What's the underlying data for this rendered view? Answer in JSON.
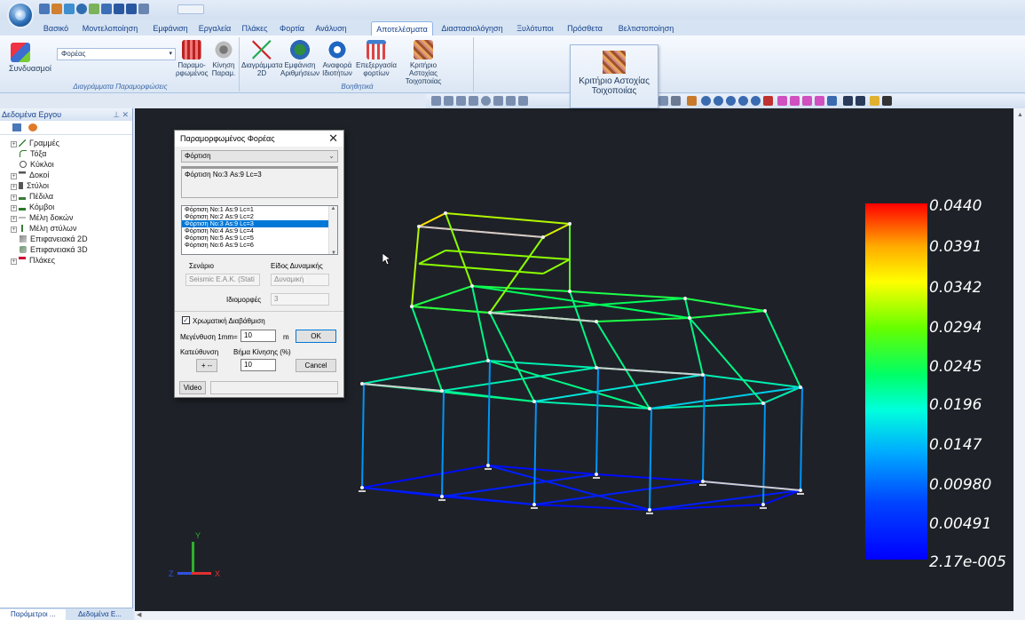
{
  "ribbon": {
    "tabs": [
      "Βασικό",
      "Μοντελοποίηση",
      "Εμφάνιση",
      "Εργαλεία",
      "Πλάκες",
      "Φορτία",
      "Ανάλυση",
      "Αποτελέσματα",
      "Διαστασιολόγηση",
      "Ξυλότυποι",
      "Πρόσθετα",
      "Βελτιστοποίηση"
    ],
    "active_tab": "Αποτελέσματα",
    "group1": {
      "label": "Διαγράμματα Παραμορφώσεις",
      "combos_label": "Συνδυασμοί",
      "combo_value": "Φορέας",
      "btn_paramorfomenos": "Παραμο- ρφωμένος",
      "btn_kinisi": "Κίνηση Παραμ."
    },
    "group2": {
      "label": "Βοηθητικά",
      "btn_diagrammata": "Διαγράμματα 2D",
      "btn_emfanisi": "Εμφάνιση Αριθμήσεων",
      "btn_anafora": "Αναφορά Ιδιοτήτων",
      "btn_epexergasia": "Επεξεργασία φορτίων",
      "btn_kritirio": "Κριτήριο Αστοχίας Τοιχοποιίας"
    },
    "tooltip": "Κριτήριο Αστοχίας Τοιχοποιίας"
  },
  "left_panel": {
    "title": "Δεδομένα Εργου",
    "pin": "⊥ ✕",
    "items": [
      "Γραμμές",
      "Τόξα",
      "Κύκλοι",
      "Δοκοί",
      "Στύλοι",
      "Πέδιλα",
      "Κόμβοι",
      "Μέλη δοκών",
      "Μέλη στύλων",
      "Επιφανειακά 2D",
      "Επιφανειακά 3D",
      "Πλάκες"
    ],
    "bottom_tabs": [
      "Παράμετροι ...",
      "Δεδομένα Ε..."
    ]
  },
  "dialog": {
    "title": "Παραμορφωμένος Φορέας",
    "combo_value": "Φόρτιση",
    "info_text": "Φόρτιση Νο:3 As:9 Lc=3",
    "list": [
      "Φόρτιση Νο:1 As:9 Lc=1",
      "Φόρτιση Νο:2 As:9 Lc=2",
      "Φόρτιση Νο:3 As:9 Lc=3",
      "Φόρτιση Νο:4 As:9 Lc=4",
      "Φόρτιση Νο:5 As:9 Lc=5",
      "Φόρτιση Νο:6 As:9 Lc=6"
    ],
    "selected_index": 2,
    "senario_label": "Σενάριο",
    "senario_value": "Seismic E.A.K. (Stati",
    "eidos_label": "Είδος Δυναμικής",
    "eidos_value": "Δυναμική",
    "idiomorfes_label": "Ιδιομορφές",
    "idiomorfes_value": "3",
    "chromatic_label": "Χρωματική Διαβάθμιση",
    "megethinsi_label": "Μεγένθυση 1mm=",
    "megethinsi_value": "10",
    "unit": "m",
    "ok": "OK",
    "kateythinsi_label": "Κατεύθυνση",
    "vima_label": "Βήμα Κίνησης (%)",
    "direction_btn": "+ --",
    "vima_value": "10",
    "cancel": "Cancel",
    "video": "Video"
  },
  "legend": {
    "values": [
      "0.0440",
      "0.0391",
      "0.0342",
      "0.0294",
      "0.0245",
      "0.0196",
      "0.0147",
      "0.00980",
      "0.00491",
      "2.17e-005"
    ]
  },
  "axes": {
    "x": "X",
    "y": "Y",
    "z": "Z"
  }
}
